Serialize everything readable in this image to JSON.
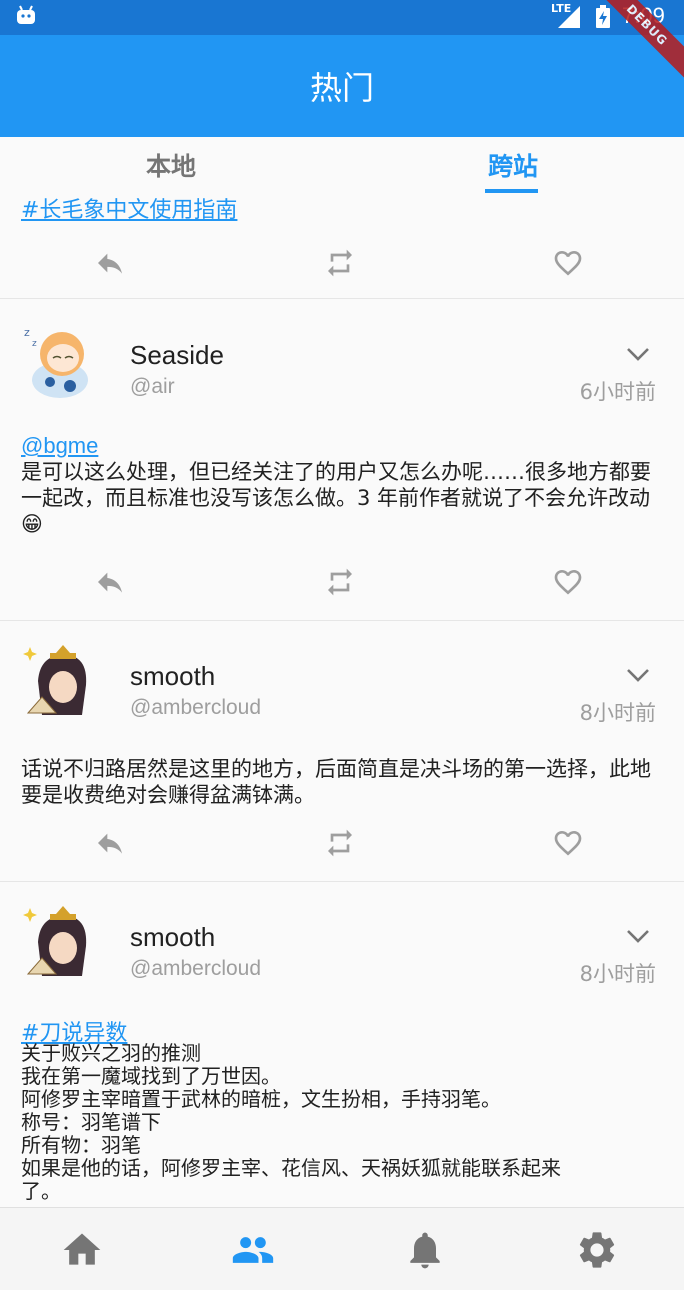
{
  "status_bar": {
    "network": "LTE",
    "time": "7:09"
  },
  "debug_banner": "DEBUG",
  "app_bar": {
    "title": "热门"
  },
  "tabs": [
    {
      "label": "本地",
      "selected": false
    },
    {
      "label": "跨站",
      "selected": true
    }
  ],
  "colors": {
    "primary": "#2196f3",
    "status_bar": "#1976d2",
    "icon_gray": "#9e9e9e",
    "text": "#212121"
  },
  "posts": [
    {
      "partial": true,
      "hashtag": "#长毛象中文使用指南",
      "actions": [
        "reply-icon",
        "boost-icon",
        "favorite-icon"
      ]
    },
    {
      "display_name": "Seaside",
      "handle": "@air",
      "time": "6小时前",
      "mention": "@bgme",
      "text": " 是可以这么处理，但已经关注了的用户又怎么办呢……很多地方都要一起改，而且标准也没写该怎么做。3 年前作者就说了不会允许改动😁",
      "actions": [
        "reply-icon",
        "boost-icon",
        "favorite-icon"
      ]
    },
    {
      "display_name": "smooth",
      "handle": "@ambercloud",
      "time": "8小时前",
      "text": "话说不归路居然是这里的地方，后面简直是决斗场的第一选择，此地要是收费绝对会赚得盆满钵满。",
      "actions": [
        "reply-icon",
        "boost-icon",
        "favorite-icon"
      ]
    },
    {
      "display_name": "smooth",
      "handle": "@ambercloud",
      "time": "8小时前",
      "hashtag": "#刀说异数",
      "lines": [
        "关于败兴之羽的推测",
        "我在第一魔域找到了万世因。",
        "阿修罗主宰暗置于武林的暗桩，文生扮相，手持羽笔。",
        "称号：羽笔谱下",
        "所有物：羽笔",
        "如果是他的话，阿修罗主宰、花信风、天祸妖狐就能联系起来",
        "了。"
      ]
    }
  ],
  "bottom_nav": [
    {
      "icon": "home-icon",
      "selected": false
    },
    {
      "icon": "people-icon",
      "selected": true
    },
    {
      "icon": "bell-icon",
      "selected": false
    },
    {
      "icon": "settings-icon",
      "selected": false
    }
  ]
}
